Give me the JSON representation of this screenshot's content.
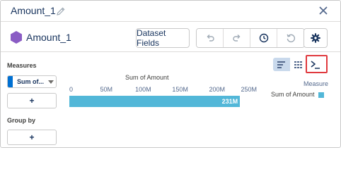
{
  "window": {
    "title": "Amount_1"
  },
  "header": {
    "name": "Amount_1",
    "dataset_fields_label": "Dataset Fields"
  },
  "left": {
    "measures_title": "Measures",
    "measure_pill": "Sum of...",
    "add_measure_label": "+",
    "group_by_title": "Group by",
    "add_group_label": "+"
  },
  "chart_data": {
    "type": "bar",
    "title": "Sum of Amount",
    "orientation": "horizontal",
    "categories": [
      ""
    ],
    "series": [
      {
        "name": "Sum of Amount",
        "values": [
          231000000
        ]
      }
    ],
    "ticks": [
      "0",
      "50M",
      "100M",
      "150M",
      "200M",
      "250M"
    ],
    "xlim": [
      0,
      250000000
    ],
    "value_label": "231M",
    "legend_title": "Measure",
    "legend_position": "right",
    "color": "#52b7d8"
  },
  "colors": {
    "accent": "#0070d2",
    "bar": "#52b7d8",
    "highlight": "#e0393e",
    "hexagon": "#8a5cc4"
  },
  "icons": {
    "edit": "pencil-icon",
    "close": "close-icon",
    "dataset": "hexagon-icon",
    "undo": "undo-icon",
    "redo": "redo-icon",
    "history": "clock-icon",
    "reset": "reset-icon",
    "settings": "gear-icon",
    "chart_view": "bar-chart-icon",
    "table_view": "table-icon",
    "formula_view": "terminal-icon"
  }
}
